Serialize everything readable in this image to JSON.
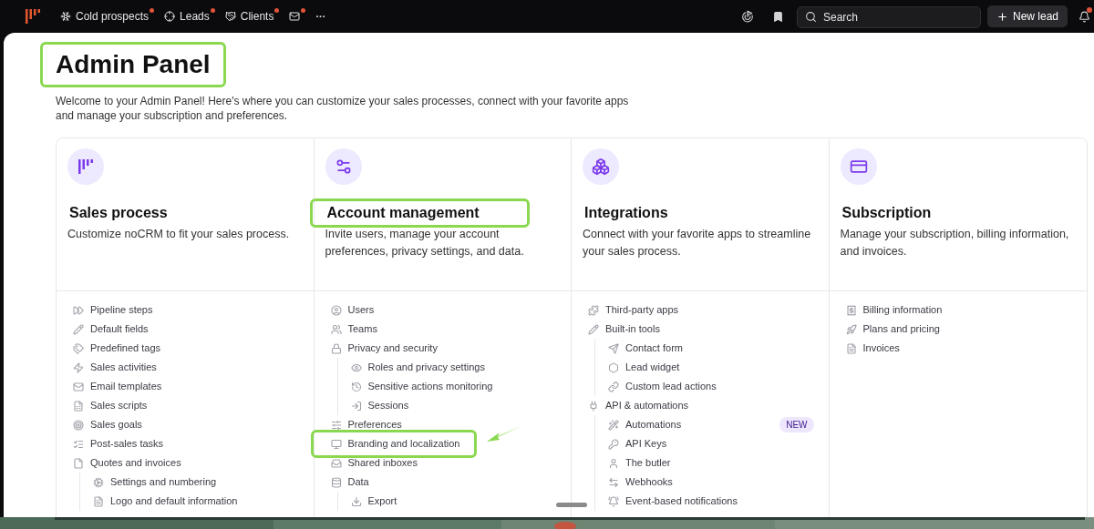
{
  "nav": {
    "items": [
      {
        "label": "Cold prospects",
        "dot": true
      },
      {
        "label": "Leads",
        "dot": true
      },
      {
        "label": "Clients",
        "dot": true
      },
      {
        "dot": true
      }
    ],
    "more": "···",
    "search": {
      "placeholder": "Search"
    },
    "new_lead": "New lead",
    "notifications_badge": true
  },
  "page": {
    "title": "Admin Panel",
    "title_highlighted": true,
    "description": "Welcome to your Admin Panel! Here's where you can customize your sales processes, connect with your favorite apps and manage your subscription and preferences."
  },
  "sections": [
    {
      "title": "Sales process",
      "highlighted": false,
      "description": "Customize noCRM to fit your sales process.",
      "items": [
        {
          "label": "Pipeline steps",
          "highlighted": false
        },
        {
          "label": "Default fields",
          "highlighted": false
        },
        {
          "label": "Predefined tags",
          "highlighted": false
        },
        {
          "label": "Sales activities",
          "highlighted": false
        },
        {
          "label": "Email templates",
          "highlighted": false
        },
        {
          "label": "Sales scripts",
          "highlighted": false
        },
        {
          "label": "Sales goals",
          "highlighted": false
        },
        {
          "label": "Post-sales tasks",
          "highlighted": false
        },
        {
          "label": "Quotes and invoices",
          "highlighted": false,
          "children": [
            {
              "label": "Settings and numbering",
              "highlighted": false
            },
            {
              "label": "Logo and default information",
              "highlighted": false
            }
          ]
        }
      ]
    },
    {
      "title": "Account management",
      "highlighted": true,
      "description": "Invite users, manage your account preferences, privacy settings, and data.",
      "items": [
        {
          "label": "Users",
          "highlighted": false
        },
        {
          "label": "Teams",
          "highlighted": false
        },
        {
          "label": "Privacy and security",
          "highlighted": false,
          "children": [
            {
              "label": "Roles and privacy settings",
              "highlighted": false
            },
            {
              "label": "Sensitive actions monitoring",
              "highlighted": false
            },
            {
              "label": "Sessions",
              "highlighted": false
            }
          ]
        },
        {
          "label": "Preferences",
          "highlighted": false
        },
        {
          "label": "Branding and localization",
          "highlighted": true
        },
        {
          "label": "Shared inboxes",
          "highlighted": false
        },
        {
          "label": "Data",
          "highlighted": false,
          "children": [
            {
              "label": "Export",
              "highlighted": false
            }
          ]
        }
      ]
    },
    {
      "title": "Integrations",
      "highlighted": false,
      "description": "Connect with your favorite apps to streamline your sales process.",
      "items": [
        {
          "label": "Third-party apps",
          "highlighted": false
        },
        {
          "label": "Built-in tools",
          "highlighted": false,
          "children": [
            {
              "label": "Contact form",
              "highlighted": false
            },
            {
              "label": "Lead widget",
              "highlighted": false
            },
            {
              "label": "Custom lead actions",
              "highlighted": false
            }
          ]
        },
        {
          "label": "API & automations",
          "highlighted": false,
          "children": [
            {
              "label": "Automations",
              "highlighted": false,
              "badge": "NEW"
            },
            {
              "label": "API Keys",
              "highlighted": false
            },
            {
              "label": "The butler",
              "highlighted": false
            },
            {
              "label": "Webhooks",
              "highlighted": false
            },
            {
              "label": "Event-based notifications",
              "highlighted": false
            }
          ]
        }
      ]
    },
    {
      "title": "Subscription",
      "highlighted": false,
      "description": "Manage your subscription, billing information, and invoices.",
      "items": [
        {
          "label": "Billing information",
          "highlighted": false
        },
        {
          "label": "Plans and pricing",
          "highlighted": false
        },
        {
          "label": "Invoices",
          "highlighted": false
        }
      ]
    }
  ]
}
